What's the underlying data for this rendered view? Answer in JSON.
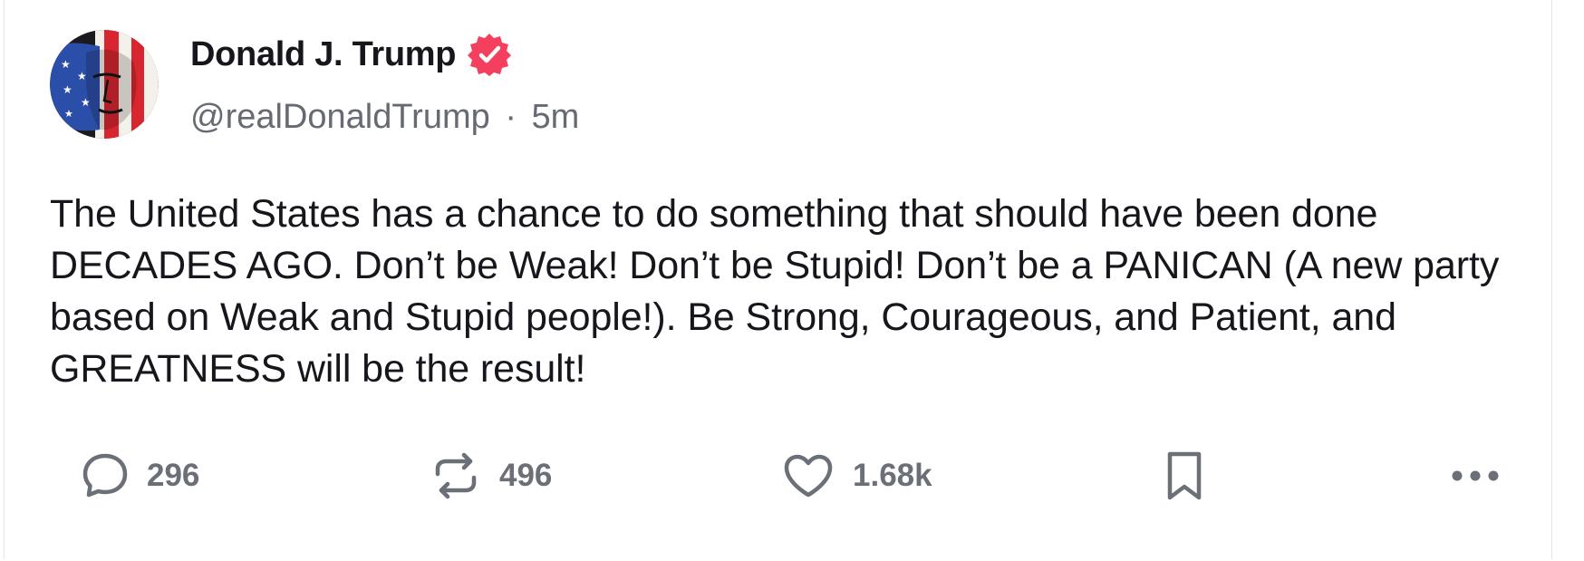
{
  "post": {
    "author": {
      "display_name": "Donald J. Trump",
      "handle": "@realDonaldTrump",
      "separator": "·",
      "time_ago": "5m",
      "verified": true,
      "verified_color": "#f43f5e"
    },
    "text": "The United States has a chance to do something that should have been done DECADES AGO. Don’t be Weak! Don’t be Stupid! Don’t be a PANICAN (A new party based on Weak and Stupid people!). Be Strong, Courageous, and Patient, and GREATNESS will be the result!",
    "actions": {
      "replies": "296",
      "retruths": "496",
      "likes": "1.68k",
      "reply_icon": "speech-bubble-icon",
      "retruth_icon": "repost-arrows-icon",
      "like_icon": "heart-icon",
      "bookmark_icon": "bookmark-icon",
      "more_icon": "more-horizontal-icon"
    }
  },
  "colors": {
    "text_primary": "#16171d",
    "text_secondary": "#666a73",
    "icon_gray": "#6b6f78",
    "background": "#ffffff"
  }
}
